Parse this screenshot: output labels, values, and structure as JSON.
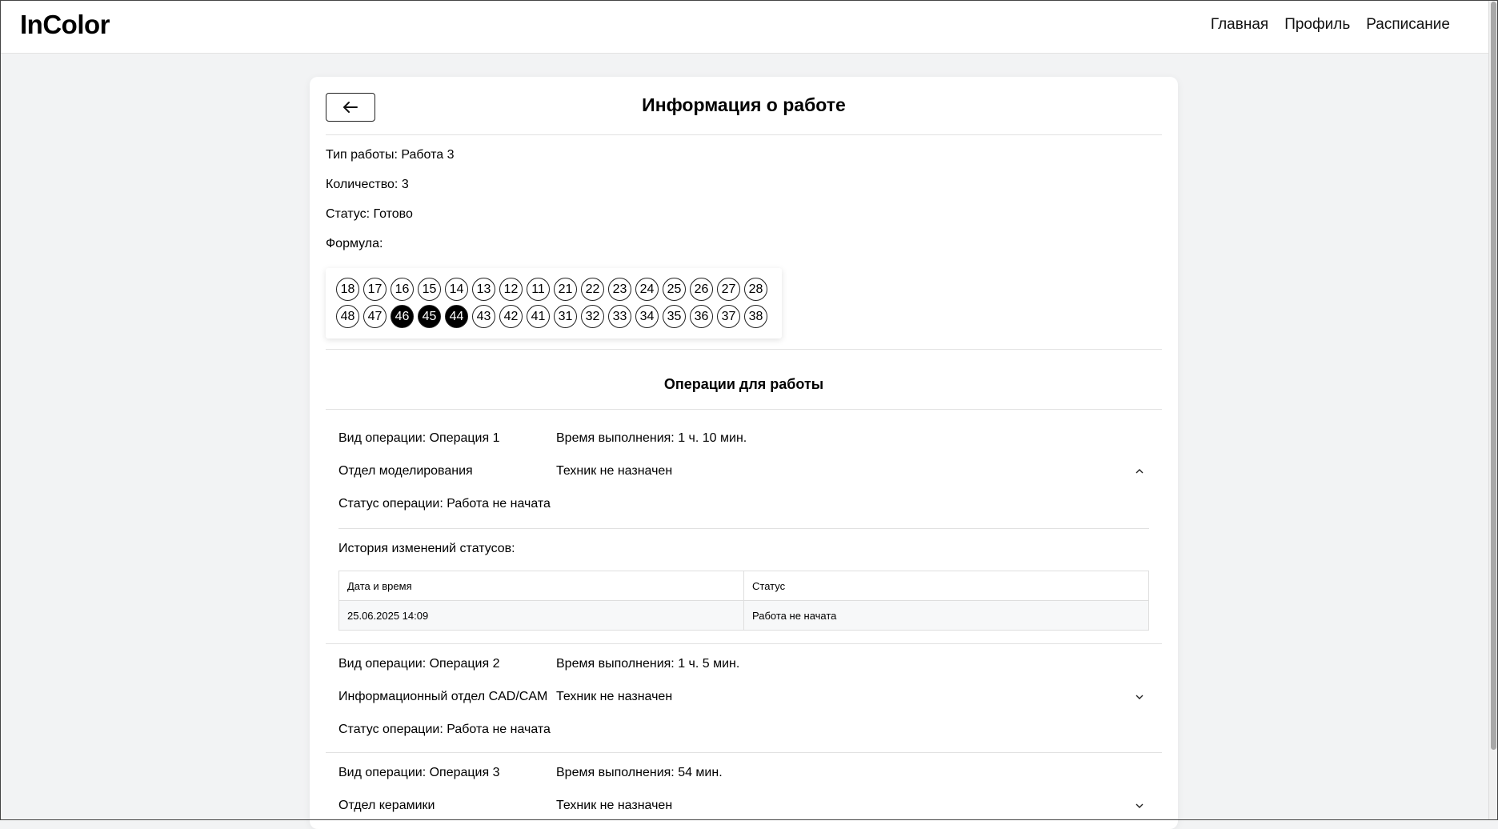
{
  "header": {
    "logo": "InColor",
    "nav": [
      "Главная",
      "Профиль",
      "Расписание"
    ]
  },
  "card": {
    "title": "Информация о работе",
    "info": {
      "type": "Тип работы: Работа 3",
      "quantity": "Количество: 3",
      "status": "Статус: Готово",
      "formula_label": "Формула:"
    },
    "formula": {
      "upper": [
        "18",
        "17",
        "16",
        "15",
        "14",
        "13",
        "12",
        "11",
        "21",
        "22",
        "23",
        "24",
        "25",
        "26",
        "27",
        "28"
      ],
      "lower": [
        "48",
        "47",
        "46",
        "45",
        "44",
        "43",
        "42",
        "41",
        "31",
        "32",
        "33",
        "34",
        "35",
        "36",
        "37",
        "38"
      ],
      "selected": [
        "46",
        "45",
        "44"
      ]
    },
    "ops_title": "Операции для работы",
    "operations": [
      {
        "kind": "Вид операции: Операция 1",
        "time": "Время выполнения: 1 ч. 10 мин.",
        "dept": "Отдел моделирования",
        "tech": "Техник не назначен",
        "status": "Статус операции: Работа не начата",
        "expanded": true,
        "history_title": "История изменений статусов:",
        "history_headers": [
          "Дата и время",
          "Статус"
        ],
        "history_rows": [
          [
            "25.06.2025 14:09",
            "Работа не начата"
          ]
        ]
      },
      {
        "kind": "Вид операции: Операция 2",
        "time": "Время выполнения: 1 ч. 5 мин.",
        "dept": "Информационный отдел CAD/CAM",
        "tech": "Техник не назначен",
        "status": "Статус операции: Работа не начата",
        "expanded": false
      },
      {
        "kind": "Вид операции: Операция 3",
        "time": "Время выполнения: 54 мин.",
        "dept": "Отдел керамики",
        "tech": "Техник не назначен",
        "expanded": false
      }
    ]
  }
}
